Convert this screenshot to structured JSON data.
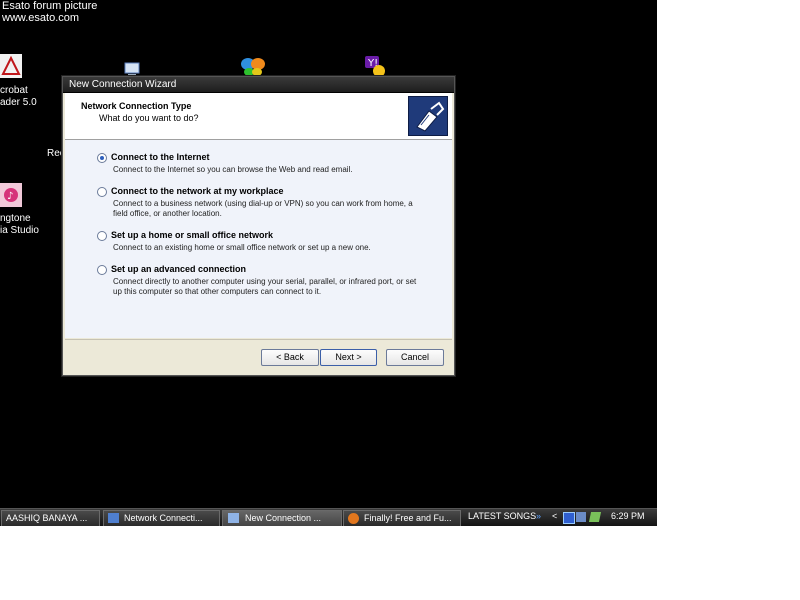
{
  "watermark": {
    "line1": "Esato forum picture",
    "line2": "www.esato.com"
  },
  "desktop": {
    "icons": [
      {
        "label1": "crobat",
        "label2": "ader 5.0"
      },
      {
        "label1": "Rec",
        "label2": ""
      },
      {
        "label1": "ngtone",
        "label2": "ia Studio"
      }
    ]
  },
  "dialog": {
    "title": "New Connection Wizard",
    "header_title": "Network Connection Type",
    "header_sub": "What do you want to do?",
    "options": [
      {
        "label": "Connect to the Internet",
        "desc": "Connect to the Internet so you can browse the Web and read email.",
        "checked": true
      },
      {
        "label": "Connect to the network at my workplace",
        "desc": "Connect to a business network (using dial-up or VPN) so you can work from home, a field office, or another location.",
        "checked": false
      },
      {
        "label": "Set up a home or small office network",
        "desc": "Connect to an existing home or small office network or set up a new one.",
        "checked": false
      },
      {
        "label": "Set up an advanced connection",
        "desc": "Connect directly to another computer using your serial, parallel, or infrared port, or set up this computer so that other computers can connect to it.",
        "checked": false
      }
    ],
    "buttons": {
      "back": "< Back",
      "next": "Next >",
      "cancel": "Cancel"
    }
  },
  "taskbar": {
    "tasks": [
      "AASHIQ BANAYA ...",
      "Network Connecti...",
      "New Connection ...",
      "Finally! Free and Fu..."
    ],
    "latest_songs": "LATEST SONGS",
    "chevron": "»",
    "tray_arrow": "<",
    "clock": "6:29 PM"
  }
}
